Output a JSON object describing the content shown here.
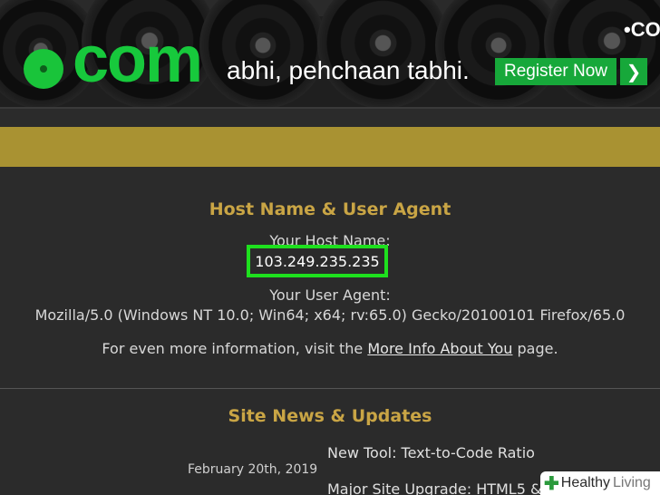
{
  "banner": {
    "brand": "com",
    "tagline": "abhi, pehchaan tabhi.",
    "register_label": "Register Now",
    "arrow_icon": "chevron-right-icon",
    "corner_brand": "•CO",
    "accent_color": "#17c93c"
  },
  "host_section": {
    "title": "Host Name & User Agent",
    "host_label": "Your Host Name:",
    "host_value": "103.249.235.235",
    "ua_label": "Your User Agent:",
    "ua_value": "Mozilla/5.0 (Windows NT 10.0; Win64; x64; rv:65.0) Gecko/20100101 Firefox/65.0",
    "info_prefix": "For even more information, visit the ",
    "info_link": "More Info About You",
    "info_suffix": " page."
  },
  "news_section": {
    "title": "Site News & Updates",
    "date": "February 20th, 2019",
    "items": [
      "New Tool: Text-to-Code Ratio",
      "Major Site Upgrade: HTML5 &"
    ]
  },
  "watermark": {
    "part1": "Healthy",
    "part2": "Living"
  }
}
